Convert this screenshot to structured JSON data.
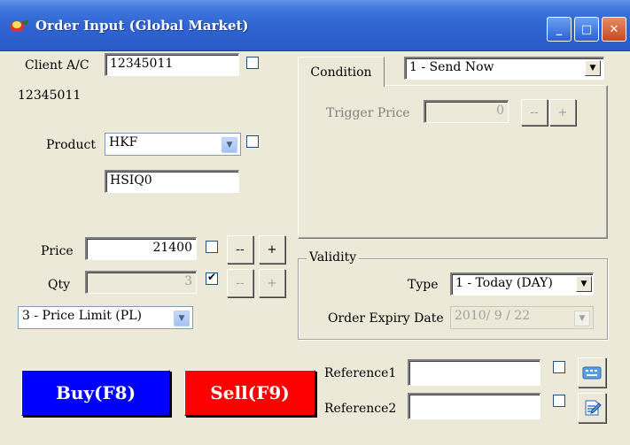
{
  "window": {
    "title": "Order Input (Global Market)",
    "minimize_glyph": "_",
    "maximize_glyph": "□",
    "close_glyph": "✕"
  },
  "client": {
    "label": "Client A/C",
    "value": "12345011",
    "name_line": "12345011"
  },
  "product": {
    "label": "Product",
    "value": "HKF",
    "code": "HSIQ0"
  },
  "price": {
    "label": "Price",
    "value": "21400",
    "dec_label": "--",
    "inc_label": "+"
  },
  "qty": {
    "label": "Qty",
    "value": "3",
    "dec_label": "--",
    "inc_label": "+"
  },
  "order_type": {
    "value": "3 - Price Limit (PL)"
  },
  "condition": {
    "tab_label": "Condition",
    "value": "1 - Send Now",
    "trigger_label": "Trigger Price",
    "trigger_value": "0",
    "dec_label": "--",
    "inc_label": "+"
  },
  "validity": {
    "group_label": "Validity",
    "type_label": "Type",
    "type_value": "1 - Today (DAY)",
    "expiry_label": "Order Expiry Date",
    "expiry_value": "2010/  9 / 22"
  },
  "actions": {
    "buy_label": "Buy(F8)",
    "sell_label": "Sell(F9)",
    "buy_color": "#0000ff",
    "sell_color": "#ff0000"
  },
  "references": {
    "ref1_label": "Reference1",
    "ref1_value": "",
    "ref2_label": "Reference2",
    "ref2_value": ""
  }
}
